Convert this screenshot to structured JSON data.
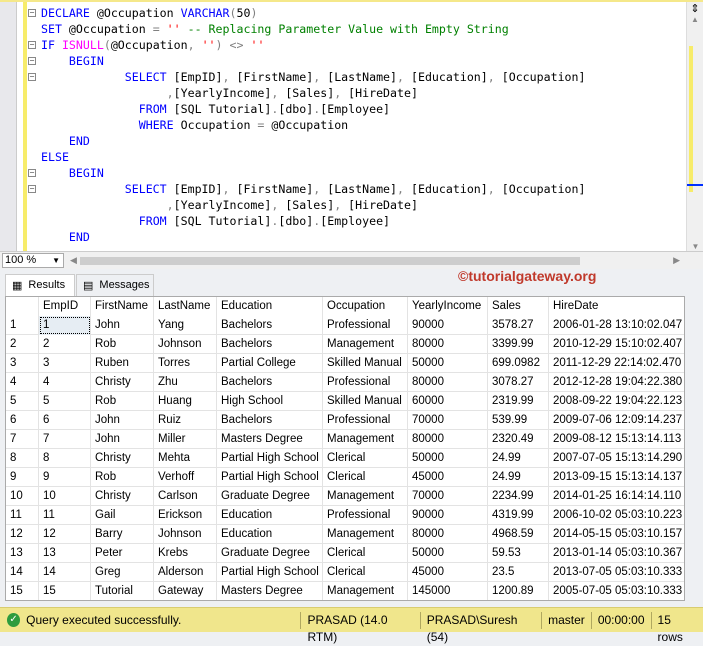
{
  "editor": {
    "lines": [
      [
        {
          "t": "DECLARE",
          "c": "kw"
        },
        {
          "t": " @Occupation "
        },
        {
          "t": "VARCHAR",
          "c": "kw"
        },
        {
          "t": "(",
          "c": "op"
        },
        {
          "t": "50"
        },
        {
          "t": ")",
          "c": "op"
        }
      ],
      [
        {
          "t": "SET",
          "c": "kw"
        },
        {
          "t": " @Occupation "
        },
        {
          "t": "=",
          "c": "op"
        },
        {
          "t": " "
        },
        {
          "t": "''",
          "c": "st"
        },
        {
          "t": " -- Replacing Parameter Value with Empty String",
          "c": "cm"
        }
      ],
      [
        {
          "t": "IF",
          "c": "kw"
        },
        {
          "t": " "
        },
        {
          "t": "ISNULL",
          "c": "fn"
        },
        {
          "t": "(",
          "c": "op"
        },
        {
          "t": "@Occupation"
        },
        {
          "t": ",",
          "c": "op"
        },
        {
          "t": " "
        },
        {
          "t": "''",
          "c": "st"
        },
        {
          "t": ")",
          "c": "op"
        },
        {
          "t": " "
        },
        {
          "t": "<>",
          "c": "op"
        },
        {
          "t": " "
        },
        {
          "t": "''",
          "c": "st"
        }
      ],
      [
        {
          "t": "    "
        },
        {
          "t": "BEGIN",
          "c": "kw"
        }
      ],
      [
        {
          "t": "            "
        },
        {
          "t": "SELECT",
          "c": "kw"
        },
        {
          "t": " [EmpID]"
        },
        {
          "t": ",",
          "c": "op"
        },
        {
          "t": " [FirstName]"
        },
        {
          "t": ",",
          "c": "op"
        },
        {
          "t": " [LastName]"
        },
        {
          "t": ",",
          "c": "op"
        },
        {
          "t": " [Education]"
        },
        {
          "t": ",",
          "c": "op"
        },
        {
          "t": " [Occupation]"
        }
      ],
      [
        {
          "t": "                  "
        },
        {
          "t": ",",
          "c": "op"
        },
        {
          "t": "[YearlyIncome]"
        },
        {
          "t": ",",
          "c": "op"
        },
        {
          "t": " [Sales]"
        },
        {
          "t": ",",
          "c": "op"
        },
        {
          "t": " [HireDate]"
        }
      ],
      [
        {
          "t": "              "
        },
        {
          "t": "FROM",
          "c": "kw"
        },
        {
          "t": " [SQL Tutorial]"
        },
        {
          "t": ".",
          "c": "op"
        },
        {
          "t": "[dbo]"
        },
        {
          "t": ".",
          "c": "op"
        },
        {
          "t": "[Employee]"
        }
      ],
      [
        {
          "t": "              "
        },
        {
          "t": "WHERE",
          "c": "kw"
        },
        {
          "t": " Occupation "
        },
        {
          "t": "=",
          "c": "op"
        },
        {
          "t": " @Occupation"
        }
      ],
      [
        {
          "t": "    "
        },
        {
          "t": "END",
          "c": "kw"
        }
      ],
      [
        {
          "t": "ELSE",
          "c": "kw"
        }
      ],
      [
        {
          "t": "    "
        },
        {
          "t": "BEGIN",
          "c": "kw"
        }
      ],
      [
        {
          "t": "            "
        },
        {
          "t": "SELECT",
          "c": "kw"
        },
        {
          "t": " [EmpID]"
        },
        {
          "t": ",",
          "c": "op"
        },
        {
          "t": " [FirstName]"
        },
        {
          "t": ",",
          "c": "op"
        },
        {
          "t": " [LastName]"
        },
        {
          "t": ",",
          "c": "op"
        },
        {
          "t": " [Education]"
        },
        {
          "t": ",",
          "c": "op"
        },
        {
          "t": " [Occupation]"
        }
      ],
      [
        {
          "t": "                  "
        },
        {
          "t": ",",
          "c": "op"
        },
        {
          "t": "[YearlyIncome]"
        },
        {
          "t": ",",
          "c": "op"
        },
        {
          "t": " [Sales]"
        },
        {
          "t": ",",
          "c": "op"
        },
        {
          "t": " [HireDate]"
        }
      ],
      [
        {
          "t": "              "
        },
        {
          "t": "FROM",
          "c": "kw"
        },
        {
          "t": " [SQL Tutorial]"
        },
        {
          "t": ".",
          "c": "op"
        },
        {
          "t": "[dbo]"
        },
        {
          "t": ".",
          "c": "op"
        },
        {
          "t": "[Employee]"
        }
      ],
      [
        {
          "t": "    "
        },
        {
          "t": "END",
          "c": "kw"
        }
      ]
    ],
    "folds": [
      0,
      2,
      3,
      4,
      10,
      11
    ]
  },
  "zoom": "100 %",
  "tabs": {
    "results": "Results",
    "messages": "Messages"
  },
  "watermark": "©tutorialgateway.org",
  "grid": {
    "columns": [
      "",
      "EmpID",
      "FirstName",
      "LastName",
      "Education",
      "Occupation",
      "YearlyIncome",
      "Sales",
      "HireDate"
    ],
    "rows": [
      [
        "1",
        "1",
        "John",
        "Yang",
        "Bachelors",
        "Professional",
        "90000",
        "3578.27",
        "2006-01-28 13:10:02.047"
      ],
      [
        "2",
        "2",
        "Rob",
        "Johnson",
        "Bachelors",
        "Management",
        "80000",
        "3399.99",
        "2010-12-29 15:10:02.407"
      ],
      [
        "3",
        "3",
        "Ruben",
        "Torres",
        "Partial College",
        "Skilled Manual",
        "50000",
        "699.0982",
        "2011-12-29 22:14:02.470"
      ],
      [
        "4",
        "4",
        "Christy",
        "Zhu",
        "Bachelors",
        "Professional",
        "80000",
        "3078.27",
        "2012-12-28 19:04:22.380"
      ],
      [
        "5",
        "5",
        "Rob",
        "Huang",
        "High School",
        "Skilled Manual",
        "60000",
        "2319.99",
        "2008-09-22 19:04:22.123"
      ],
      [
        "6",
        "6",
        "John",
        "Ruiz",
        "Bachelors",
        "Professional",
        "70000",
        "539.99",
        "2009-07-06 12:09:14.237"
      ],
      [
        "7",
        "7",
        "John",
        "Miller",
        "Masters Degree",
        "Management",
        "80000",
        "2320.49",
        "2009-08-12 15:13:14.113"
      ],
      [
        "8",
        "8",
        "Christy",
        "Mehta",
        "Partial High School",
        "Clerical",
        "50000",
        "24.99",
        "2007-07-05 15:13:14.290"
      ],
      [
        "9",
        "9",
        "Rob",
        "Verhoff",
        "Partial High School",
        "Clerical",
        "45000",
        "24.99",
        "2013-09-15 15:13:14.137"
      ],
      [
        "10",
        "10",
        "Christy",
        "Carlson",
        "Graduate Degree",
        "Management",
        "70000",
        "2234.99",
        "2014-01-25 16:14:14.110"
      ],
      [
        "11",
        "11",
        "Gail",
        "Erickson",
        "Education",
        "Professional",
        "90000",
        "4319.99",
        "2006-10-02 05:03:10.223"
      ],
      [
        "12",
        "12",
        "Barry",
        "Johnson",
        "Education",
        "Management",
        "80000",
        "4968.59",
        "2014-05-15 05:03:10.157"
      ],
      [
        "13",
        "13",
        "Peter",
        "Krebs",
        "Graduate Degree",
        "Clerical",
        "50000",
        "59.53",
        "2013-01-14 05:03:10.367"
      ],
      [
        "14",
        "14",
        "Greg",
        "Alderson",
        "Partial High School",
        "Clerical",
        "45000",
        "23.5",
        "2013-07-05 05:03:10.333"
      ],
      [
        "15",
        "15",
        "Tutorial",
        "Gateway",
        "Masters Degree",
        "Management",
        "145000",
        "1200.89",
        "2005-07-05 05:03:10.333"
      ]
    ]
  },
  "status": {
    "message": "Query executed successfully.",
    "server": "PRASAD (14.0 RTM)",
    "user": "PRASAD\\Suresh (54)",
    "database": "master",
    "elapsed": "00:00:00",
    "rows": "15 rows"
  },
  "colors": {
    "status_bar": "#f0e68c",
    "keyword": "#0000ff",
    "function": "#ff00ff",
    "comment": "#008000",
    "string": "#ff0000",
    "watermark": "#c0392b"
  }
}
